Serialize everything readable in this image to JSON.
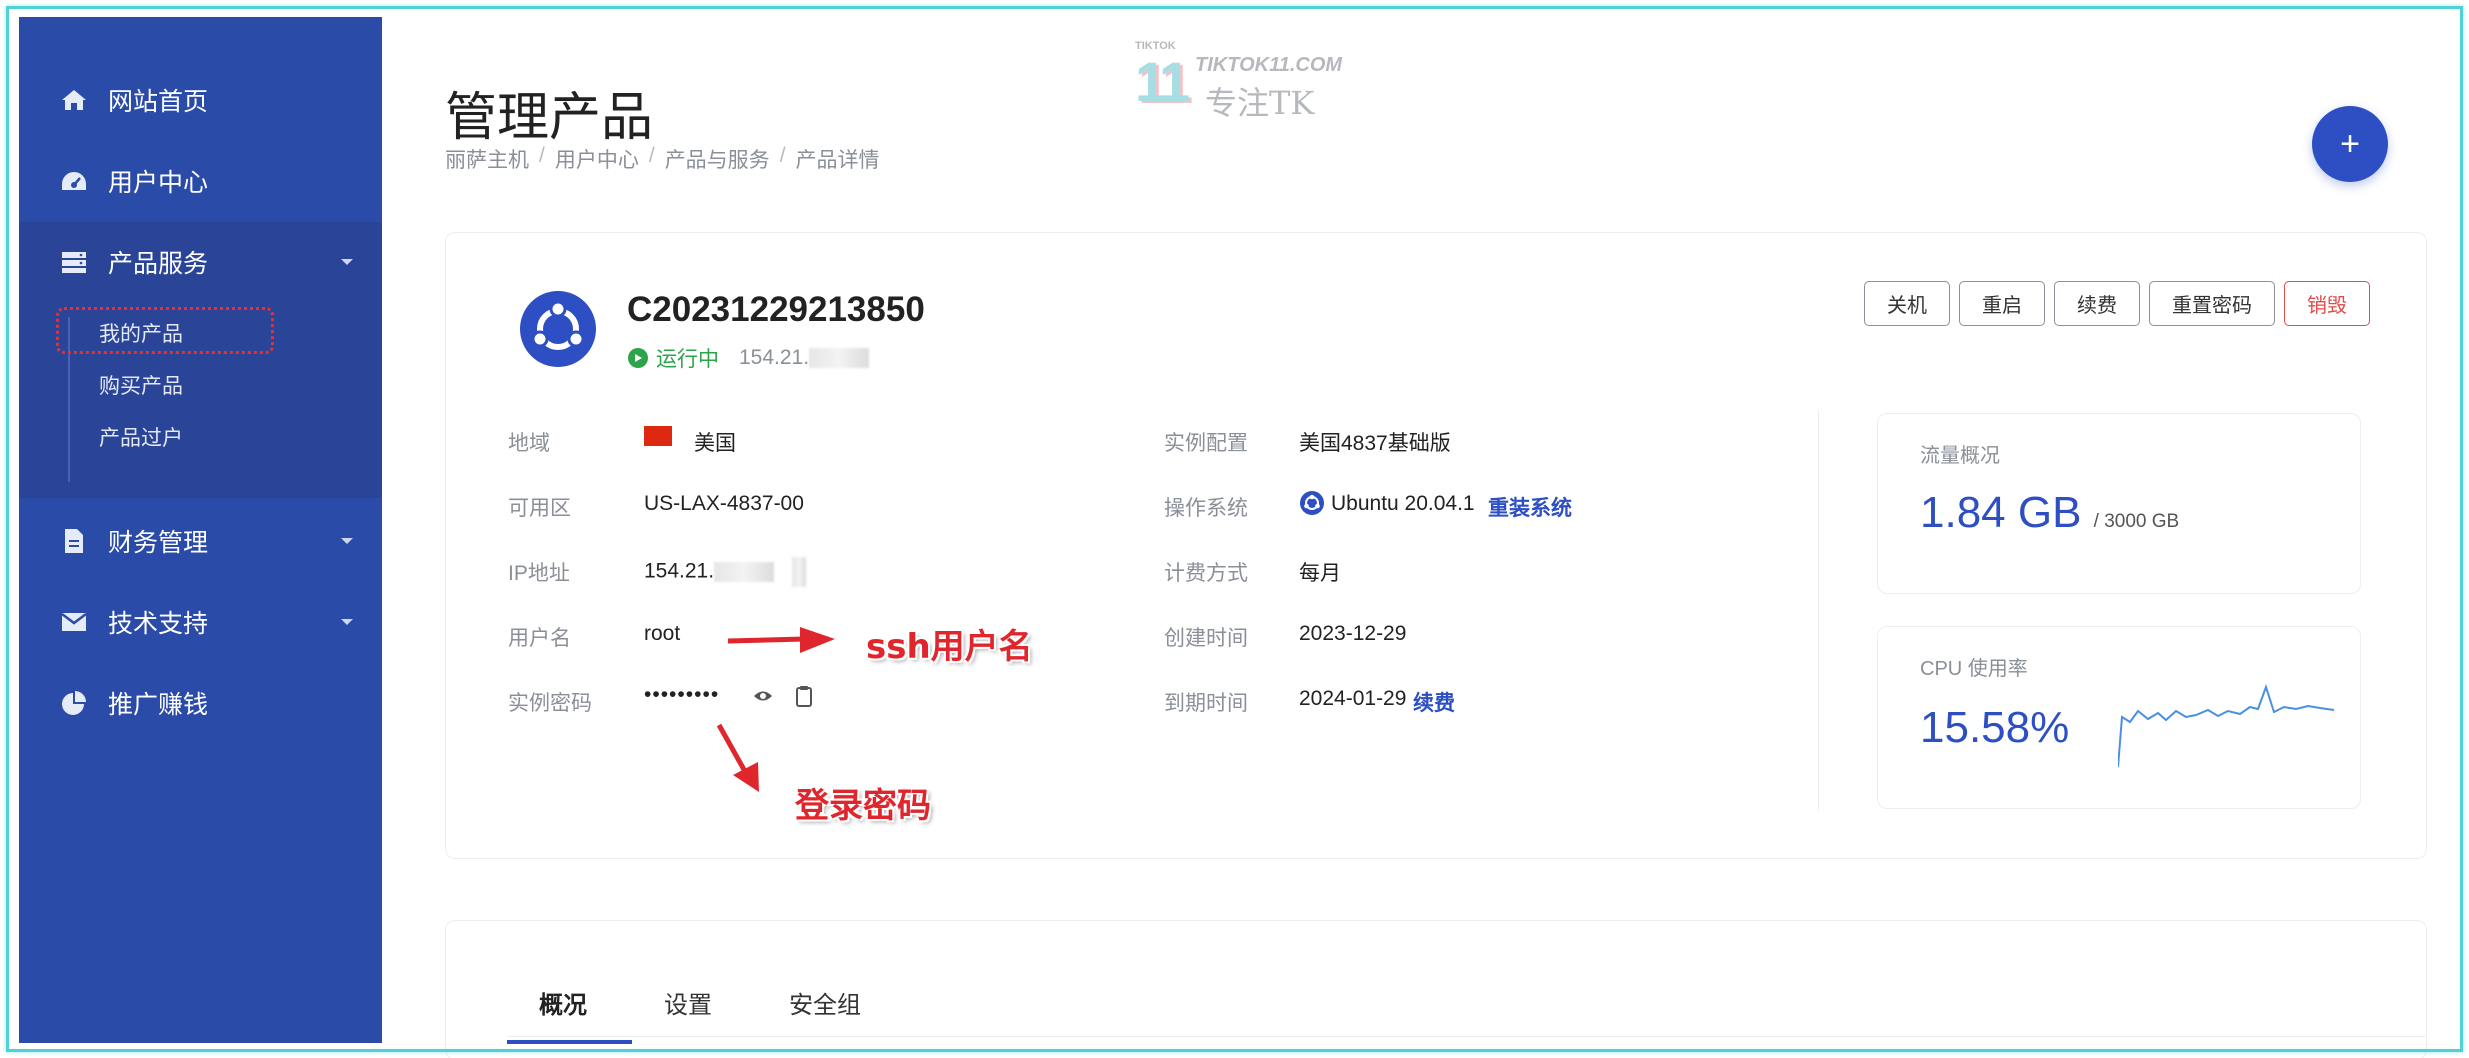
{
  "sidebar": {
    "items": [
      {
        "label": "网站首页",
        "icon": "home-icon"
      },
      {
        "label": "用户中心",
        "icon": "dashboard-icon"
      },
      {
        "label": "产品服务",
        "icon": "server-icon"
      },
      {
        "label": "财务管理",
        "icon": "document-icon"
      },
      {
        "label": "技术支持",
        "icon": "envelope-icon"
      },
      {
        "label": "推广赚钱",
        "icon": "pie-chart-icon"
      }
    ],
    "sub_items": [
      "我的产品",
      "购买产品",
      "产品过户"
    ]
  },
  "header": {
    "title": "管理产品",
    "breadcrumb": [
      "丽萨主机",
      "用户中心",
      "产品与服务",
      "产品详情"
    ],
    "add_button": "+"
  },
  "watermark": {
    "brand": "TIKTOK11.COM",
    "prefix": "TIKTOK",
    "number": "11",
    "tagline": "专注TK"
  },
  "product": {
    "id": "C20231229213850",
    "status": "运行中",
    "ip_prefix": "154.21.",
    "actions": [
      "关机",
      "重启",
      "续费",
      "重置密码",
      "销毁"
    ]
  },
  "details_left": [
    {
      "label": "地域",
      "value": "美国"
    },
    {
      "label": "可用区",
      "value": "US-LAX-4837-00"
    },
    {
      "label": "IP地址",
      "value": "154.21."
    },
    {
      "label": "用户名",
      "value": "root"
    },
    {
      "label": "实例密码",
      "value": "•••••••••"
    }
  ],
  "details_right": [
    {
      "label": "实例配置",
      "value": "美国4837基础版"
    },
    {
      "label": "操作系统",
      "value": "Ubuntu 20.04.1",
      "link": "重装系统"
    },
    {
      "label": "计费方式",
      "value": "每月"
    },
    {
      "label": "创建时间",
      "value": "2023-12-29"
    },
    {
      "label": "到期时间",
      "value": "2024-01-29",
      "link": "续费"
    }
  ],
  "traffic": {
    "title": "流量概况",
    "used": "1.84 GB",
    "total": "/ 3000 GB"
  },
  "cpu": {
    "title": "CPU 使用率",
    "value": "15.58%"
  },
  "annotations": {
    "ssh": "ssh用户名",
    "password": "登录密码"
  },
  "tabs": [
    "概况",
    "设置",
    "安全组"
  ],
  "colors": {
    "sidebar": "#2b4ba8",
    "accent": "#2d4fc3",
    "running": "#2ca44a",
    "danger": "#e34a4a",
    "annotation": "#e0262d"
  }
}
